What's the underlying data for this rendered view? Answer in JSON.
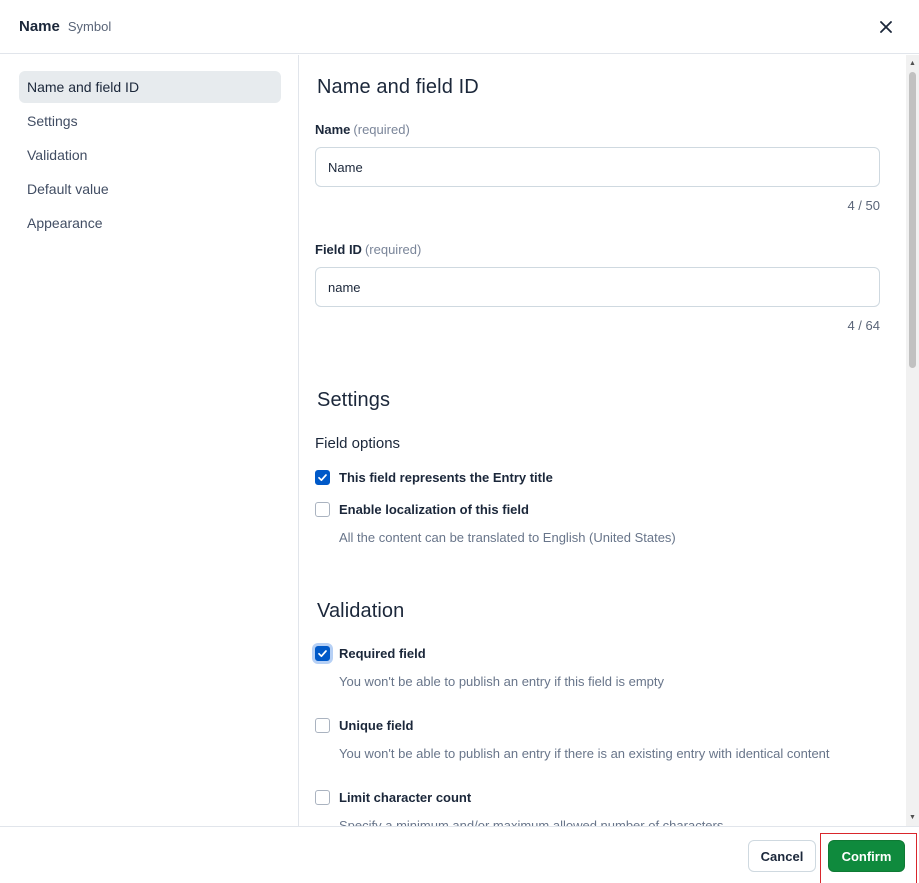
{
  "header": {
    "title": "Name",
    "subtitle": "Symbol"
  },
  "sidebar": {
    "items": [
      {
        "label": "Name and field ID"
      },
      {
        "label": "Settings"
      },
      {
        "label": "Validation"
      },
      {
        "label": "Default value"
      },
      {
        "label": "Appearance"
      }
    ]
  },
  "name_section": {
    "title": "Name and field ID",
    "name_label": "Name",
    "name_required": "(required)",
    "name_value": "Name",
    "name_counter": "4 / 50",
    "fieldid_label": "Field ID",
    "fieldid_required": "(required)",
    "fieldid_value": "name",
    "fieldid_counter": "4 / 64"
  },
  "settings_section": {
    "title": "Settings",
    "field_options_heading": "Field options",
    "entry_title_label": "This field represents the Entry title",
    "entry_title_checked": true,
    "localization_label": "Enable localization of this field",
    "localization_checked": false,
    "localization_help": "All the content can be translated to English (United States)"
  },
  "validation_section": {
    "title": "Validation",
    "required_label": "Required field",
    "required_checked": true,
    "required_help": "You won't be able to publish an entry if this field is empty",
    "unique_label": "Unique field",
    "unique_checked": false,
    "unique_help": "You won't be able to publish an entry if there is an existing entry with identical content",
    "limit_label": "Limit character count",
    "limit_checked": false,
    "limit_help": "Specify a minimum and/or maximum allowed number of characters"
  },
  "footer": {
    "cancel_label": "Cancel",
    "confirm_label": "Confirm"
  },
  "colors": {
    "primary_blue": "#0059c8",
    "confirm_green": "#0f8a3d",
    "highlight_red": "#d9262c"
  }
}
